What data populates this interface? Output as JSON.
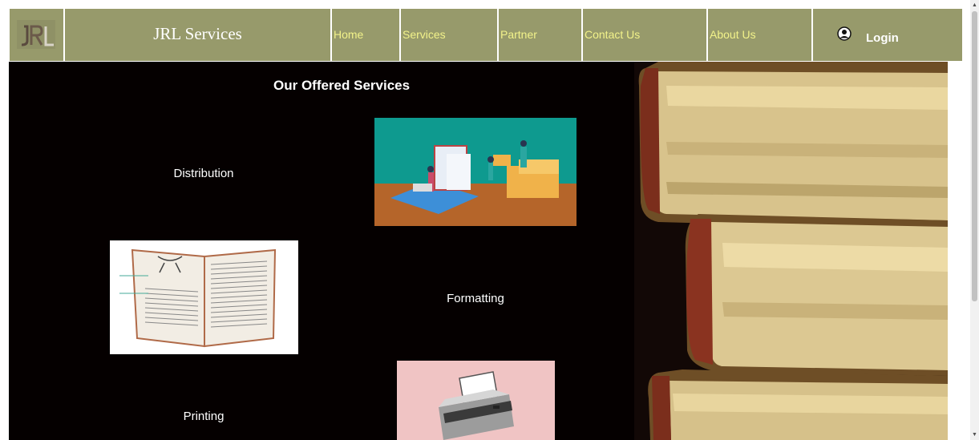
{
  "header": {
    "brand": "JRL Services",
    "logo_text": "JRL",
    "nav": [
      {
        "label": "Home"
      },
      {
        "label": "Services"
      },
      {
        "label": "Partner"
      },
      {
        "label": "Contact Us"
      },
      {
        "label": "About Us"
      }
    ],
    "login_label": "Login"
  },
  "main": {
    "title": "Our Offered Services",
    "services": [
      {
        "label": "Distribution"
      },
      {
        "label": "Formatting"
      },
      {
        "label": "Printing"
      }
    ]
  },
  "colors": {
    "nav_bg": "#979a6b",
    "nav_link": "#f2f28a",
    "main_bg": "#050000"
  },
  "icons": [
    "user-circle-icon",
    "scroll-up-icon",
    "scroll-down-icon"
  ]
}
